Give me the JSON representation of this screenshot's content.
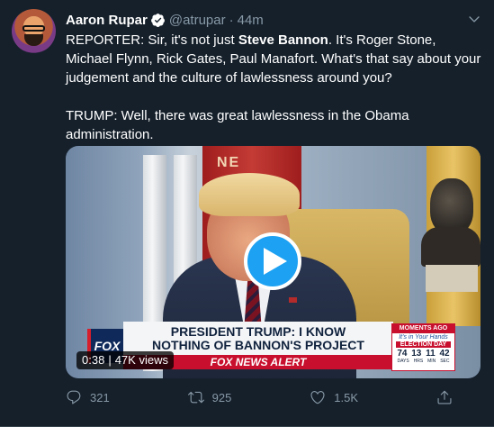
{
  "tweet": {
    "author_name": "Aaron Rupar",
    "handle": "@atrupar",
    "separator": "·",
    "time": "44m",
    "text_para1_a": "REPORTER: Sir, it's not just ",
    "text_para1_bold": "Steve Bannon",
    "text_para1_b": ". It's Roger Stone, Michael Flynn, Rick Gates, Paul Manafort. What's that say about your judgement and the culture of lawlessness around you?",
    "text_para2": "TRUMP: Well, there was great lawlessness in the Obama administration."
  },
  "media": {
    "duration": "0:38",
    "separator": "|",
    "views": "47K views",
    "chyron_headline_line1": "PRESIDENT TRUMP: I KNOW",
    "chyron_headline_line2": "NOTHING OF BANNON'S PROJECT",
    "chyron_strip": "FOX NEWS ALERT",
    "fox_logo": "FOX",
    "flag_text": "NE",
    "clock_title": "MOMENTS AGO",
    "clock_subtitle": "It's in Your Hands",
    "clock_event": "ELECTION DAY",
    "clock_values": [
      "74",
      "13",
      "11",
      "42"
    ],
    "clock_units": [
      "DAYS",
      "HRS",
      "MIN",
      "SEC"
    ]
  },
  "actions": {
    "replies": "321",
    "retweets": "925",
    "likes": "1.5K"
  },
  "colors": {
    "background": "#15202b",
    "accent": "#1da1f2",
    "muted": "#8899a6"
  },
  "icons": [
    "verified-badge-icon",
    "chevron-down-icon",
    "play-icon",
    "reply-icon",
    "retweet-icon",
    "like-icon",
    "share-icon"
  ]
}
